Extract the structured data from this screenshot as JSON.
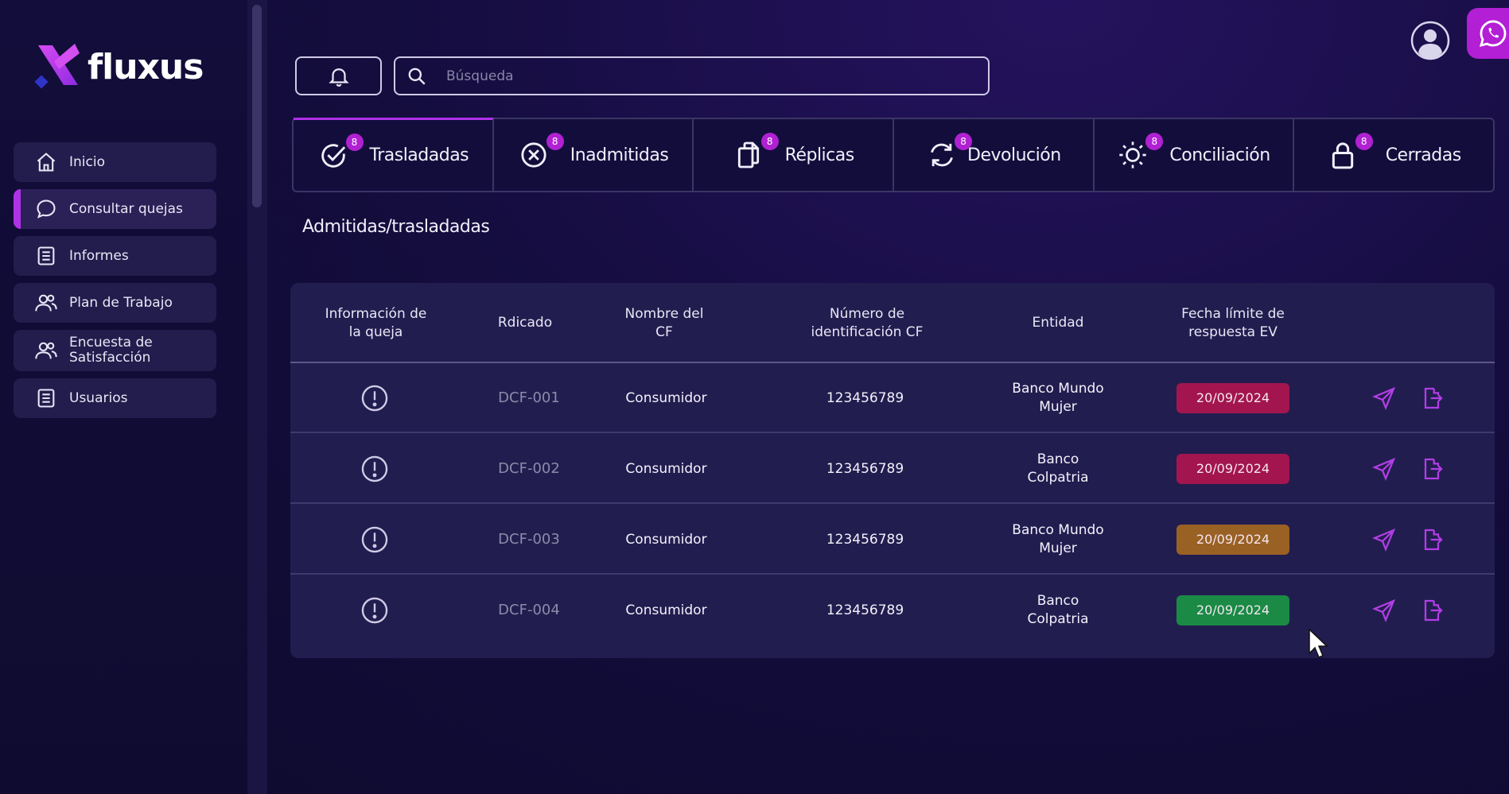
{
  "brand": {
    "name": "fluxus"
  },
  "sidebar": {
    "items": [
      {
        "label": "Inicio",
        "icon": "home-icon",
        "active": false
      },
      {
        "label": "Consultar quejas",
        "icon": "chat-bubble-icon",
        "active": true
      },
      {
        "label": "Informes",
        "icon": "document-list-icon",
        "active": false
      },
      {
        "label": "Plan de Trabajo",
        "icon": "users-icon",
        "active": false
      },
      {
        "label": "Encuesta de Satisfacción",
        "icon": "users-icon",
        "active": false
      },
      {
        "label": "Usuarios",
        "icon": "document-list-icon",
        "active": false
      }
    ]
  },
  "topbar": {
    "search_placeholder": "Búsqueda"
  },
  "tabs": [
    {
      "label": "Trasladadas",
      "badge": "8",
      "icon": "check-circle-icon",
      "active": true
    },
    {
      "label": "Inadmitidas",
      "badge": "8",
      "icon": "x-circle-icon",
      "active": false
    },
    {
      "label": "Réplicas",
      "badge": "8",
      "icon": "copy-icon",
      "active": false
    },
    {
      "label": "Devolución",
      "badge": "8",
      "icon": "refresh-icon",
      "active": false
    },
    {
      "label": "Conciliación",
      "badge": "8",
      "icon": "sun-icon",
      "active": false
    },
    {
      "label": "Cerradas",
      "badge": "8",
      "icon": "lock-icon",
      "active": false
    }
  ],
  "section": {
    "title": "Admitidas/trasladadas"
  },
  "table": {
    "headers": {
      "info": "Información de la queja",
      "radicado": "Rdicado",
      "nombre": "Nombre del CF",
      "numero": "Número de identificación CF",
      "entidad": "Entidad",
      "fecha": "Fecha límite de respuesta EV"
    },
    "rows": [
      {
        "radicado": "DCF-001",
        "nombre": "Consumidor",
        "numero": "123456789",
        "entidad": "Banco Mundo Mujer",
        "fecha": "20/09/2024",
        "status_color": "#a3154e"
      },
      {
        "radicado": "DCF-002",
        "nombre": "Consumidor",
        "numero": "123456789",
        "entidad": "Banco Colpatria",
        "fecha": "20/09/2024",
        "status_color": "#a3154e"
      },
      {
        "radicado": "DCF-003",
        "nombre": "Consumidor",
        "numero": "123456789",
        "entidad": "Banco Mundo Mujer",
        "fecha": "20/09/2024",
        "status_color": "#9a6125"
      },
      {
        "radicado": "DCF-004",
        "nombre": "Consumidor",
        "numero": "123456789",
        "entidad": "Banco Colpatria",
        "fecha": "20/09/2024",
        "status_color": "#1a8a45"
      }
    ]
  },
  "colors": {
    "accent": "#b032e8",
    "background": "#140d3e",
    "card": "#221d4f"
  }
}
